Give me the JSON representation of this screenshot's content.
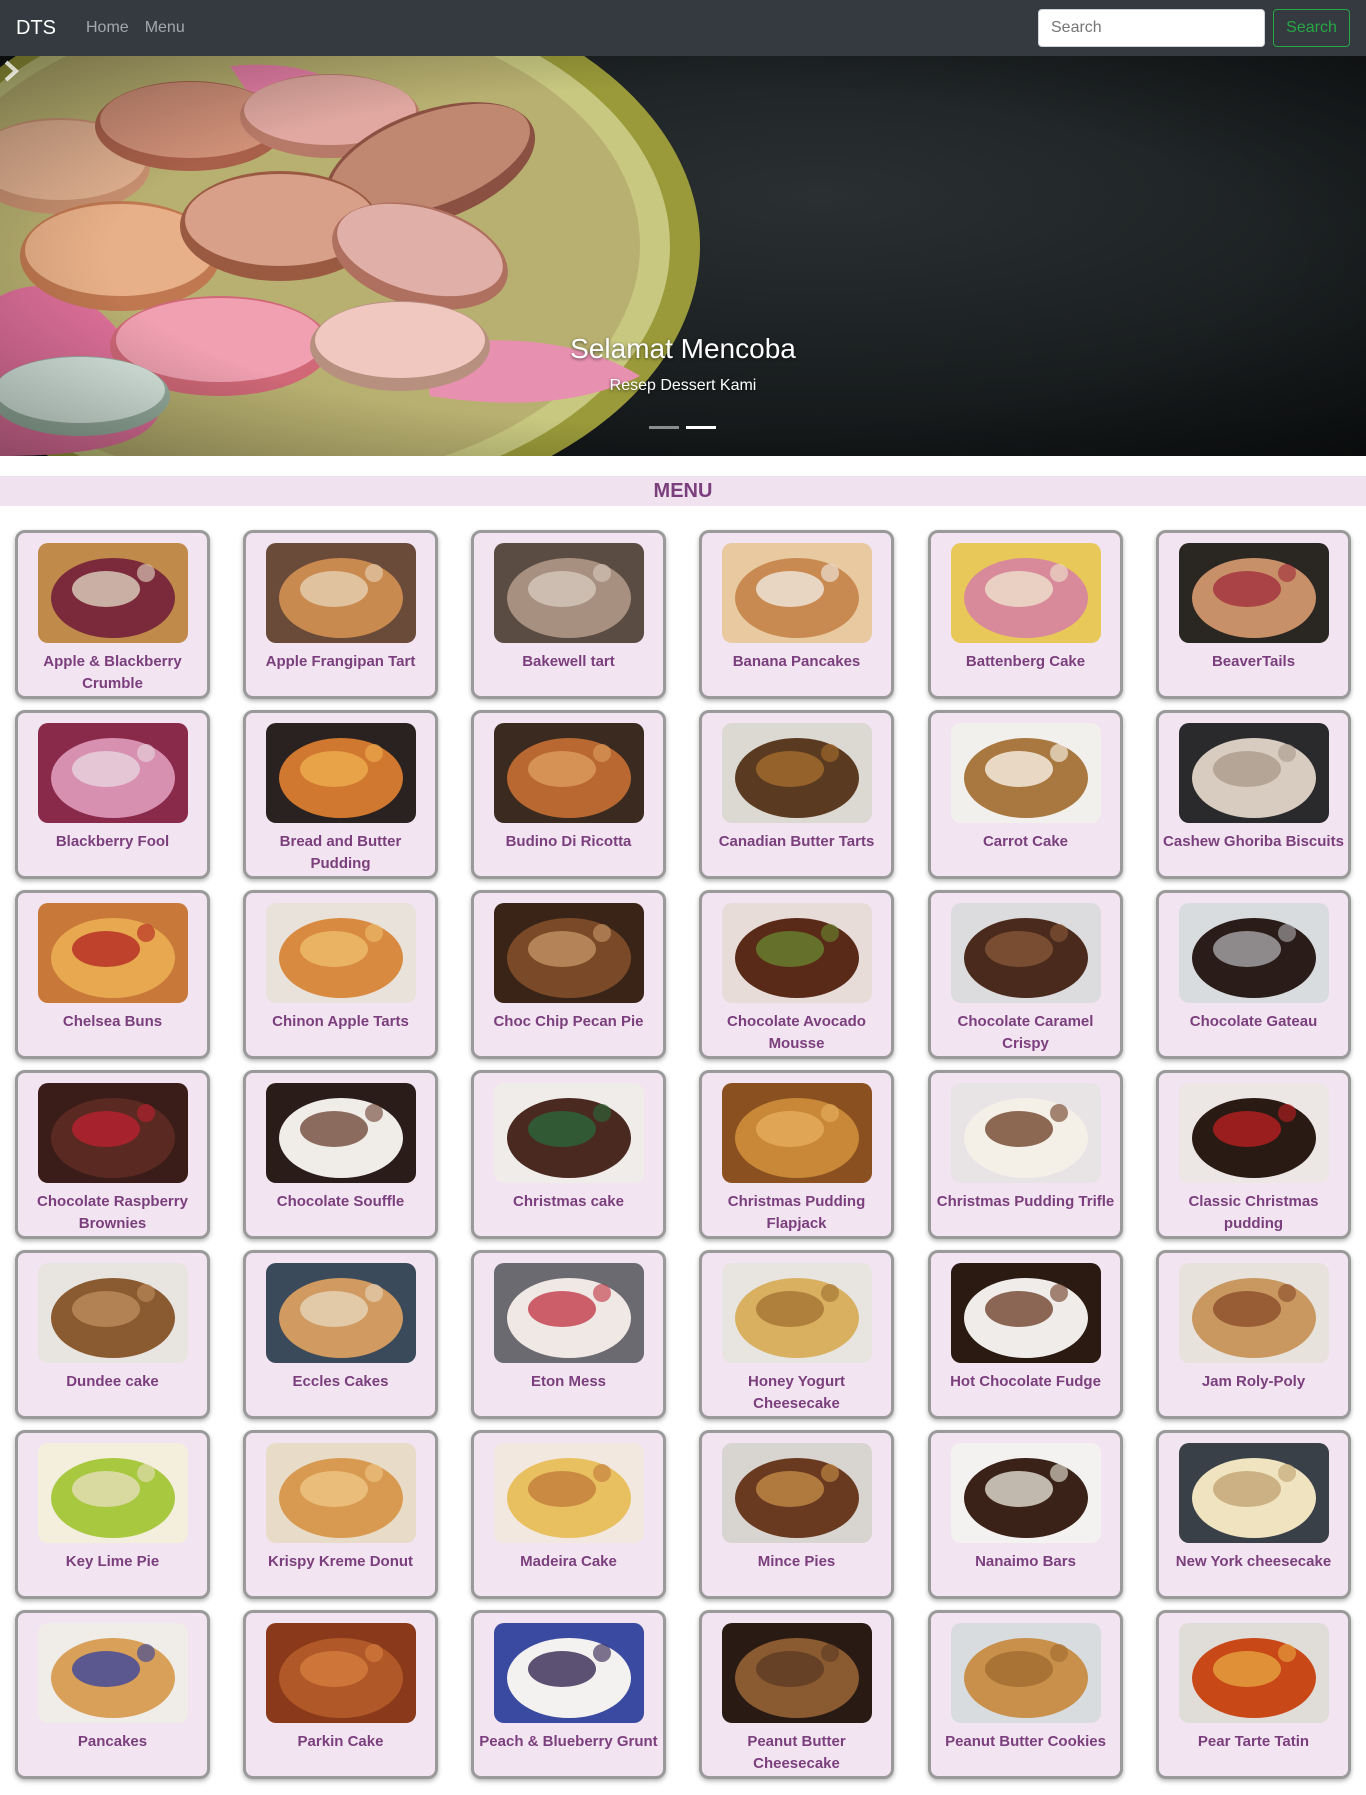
{
  "navbar": {
    "brand": "DTS",
    "links": [
      "Home",
      "Menu"
    ],
    "search_placeholder": "Search",
    "search_button": "Search"
  },
  "carousel": {
    "title": "Selamat Mencoba",
    "subtitle": "Resep Dessert Kami",
    "indicator_count": 2,
    "active_index": 1
  },
  "menu": {
    "heading": "MENU",
    "items": [
      {
        "name": "Apple & Blackberry Crumble",
        "colors": [
          "#c08a4a",
          "#7a2a3a",
          "#e6dcc8"
        ]
      },
      {
        "name": "Apple Frangipan Tart",
        "colors": [
          "#6a4a38",
          "#c98a50",
          "#e8d4b8"
        ]
      },
      {
        "name": "Bakewell tart",
        "colors": [
          "#5a4c42",
          "#a89080",
          "#d8ccc0"
        ]
      },
      {
        "name": "Banana Pancakes",
        "colors": [
          "#e8c9a0",
          "#c88a50",
          "#f4efe8"
        ]
      },
      {
        "name": "Battenberg Cake",
        "colors": [
          "#e8c858",
          "#d88a9a",
          "#f0e6d0"
        ]
      },
      {
        "name": "BeaverTails",
        "colors": [
          "#2a2622",
          "#c89068",
          "#a02a3a"
        ]
      },
      {
        "name": "Blackberry Fool",
        "colors": [
          "#8a2a4a",
          "#d890b0",
          "#e8d8e0"
        ]
      },
      {
        "name": "Bread and Butter Pudding",
        "colors": [
          "#2a2220",
          "#d07830",
          "#f0b050"
        ]
      },
      {
        "name": "Budino Di Ricotta",
        "colors": [
          "#3a2a20",
          "#b86830",
          "#e0a060"
        ]
      },
      {
        "name": "Canadian Butter Tarts",
        "colors": [
          "#dcd8d2",
          "#5a3a20",
          "#a8702e"
        ]
      },
      {
        "name": "Carrot Cake",
        "colors": [
          "#f2f0ec",
          "#a87840",
          "#fffaf0"
        ]
      },
      {
        "name": "Cashew Ghoriba Biscuits",
        "colors": [
          "#2a2a2c",
          "#d8ccc0",
          "#a89888"
        ]
      },
      {
        "name": "Chelsea Buns",
        "colors": [
          "#c87838",
          "#e8a850",
          "#b02020"
        ]
      },
      {
        "name": "Chinon Apple Tarts",
        "colors": [
          "#e8e2da",
          "#d88a40",
          "#f0c070"
        ]
      },
      {
        "name": "Choc Chip Pecan Pie",
        "colors": [
          "#3a2418",
          "#7a4a28",
          "#c89868"
        ]
      },
      {
        "name": "Chocolate Avocado Mousse",
        "colors": [
          "#e8dcd8",
          "#5a2a18",
          "#6a8a30"
        ]
      },
      {
        "name": "Chocolate Caramel Crispy",
        "colors": [
          "#dcdcde",
          "#4a2a1c",
          "#8a5a38"
        ]
      },
      {
        "name": "Chocolate Gateau",
        "colors": [
          "#d8dcde",
          "#2a1c18",
          "#b0aeb0"
        ]
      },
      {
        "name": "Chocolate Raspberry Brownies",
        "colors": [
          "#3a1c18",
          "#5a2a22",
          "#c02030"
        ]
      },
      {
        "name": "Chocolate Souffle",
        "colors": [
          "#2a1c18",
          "#f0ece8",
          "#6a4030"
        ]
      },
      {
        "name": "Christmas cake",
        "colors": [
          "#f0ecea",
          "#4a2a20",
          "#2a6a3a"
        ]
      },
      {
        "name": "Christmas Pudding Flapjack",
        "colors": [
          "#8a5020",
          "#c88838",
          "#e8b060"
        ]
      },
      {
        "name": "Christmas Pudding Trifle",
        "colors": [
          "#e8e4e6",
          "#f4f0e8",
          "#6a3a20"
        ]
      },
      {
        "name": "Classic Christmas pudding",
        "colors": [
          "#ece6e4",
          "#2a1a14",
          "#c02020"
        ]
      },
      {
        "name": "Dundee cake",
        "colors": [
          "#e8e4e0",
          "#8a5a30",
          "#c09060"
        ]
      },
      {
        "name": "Eccles Cakes",
        "colors": [
          "#3a4a5a",
          "#d09a60",
          "#e8d8c0"
        ]
      },
      {
        "name": "Eton Mess",
        "colors": [
          "#6a6a70",
          "#f0e8e4",
          "#c03040"
        ]
      },
      {
        "name": "Honey Yogurt Cheesecake",
        "colors": [
          "#e8e4e0",
          "#d8b060",
          "#a07030"
        ]
      },
      {
        "name": "Hot Chocolate Fudge",
        "colors": [
          "#2a1a12",
          "#f0ecea",
          "#6a3a22"
        ]
      },
      {
        "name": "Jam Roly-Poly",
        "colors": [
          "#e8e2dc",
          "#c89860",
          "#8a4a28"
        ]
      },
      {
        "name": "Key Lime Pie",
        "colors": [
          "#f4eedc",
          "#a8c840",
          "#e8e0c0"
        ]
      },
      {
        "name": "Krispy Kreme Donut",
        "colors": [
          "#e8dcc8",
          "#d89a50",
          "#f0c888"
        ]
      },
      {
        "name": "Madeira Cake",
        "colors": [
          "#f2e8e0",
          "#e8c060",
          "#c07838"
        ]
      },
      {
        "name": "Mince Pies",
        "colors": [
          "#d8d4d0",
          "#6a3a20",
          "#c89048"
        ]
      },
      {
        "name": "Nanaimo Bars",
        "colors": [
          "#f4f2f0",
          "#3a2218",
          "#f0ece0"
        ]
      },
      {
        "name": "New York cheesecake",
        "colors": [
          "#3a4048",
          "#f0e4c0",
          "#c0a070"
        ]
      },
      {
        "name": "Pancakes",
        "colors": [
          "#f0ece8",
          "#d8a058",
          "#3040a0"
        ]
      },
      {
        "name": "Parkin Cake",
        "colors": [
          "#8a3a1a",
          "#b05828",
          "#d88040"
        ]
      },
      {
        "name": "Peach & Blueberry Grunt",
        "colors": [
          "#3a4aa0",
          "#f4f2f0",
          "#2a1a4a"
        ]
      },
      {
        "name": "Peanut Butter Cheesecake",
        "colors": [
          "#2a1a14",
          "#8a5a30",
          "#5a3a22"
        ]
      },
      {
        "name": "Peanut Butter Cookies",
        "colors": [
          "#d8dcde",
          "#c8904a",
          "#a06a30"
        ]
      },
      {
        "name": "Pear Tarte Tatin",
        "colors": [
          "#e0dcd8",
          "#c84818",
          "#e8a840"
        ]
      }
    ]
  },
  "colors": {
    "navbar_bg": "#343a40",
    "accent_green": "#28a745",
    "menu_purple": "#7b3f7e",
    "card_bg": "#f2e4f0"
  }
}
